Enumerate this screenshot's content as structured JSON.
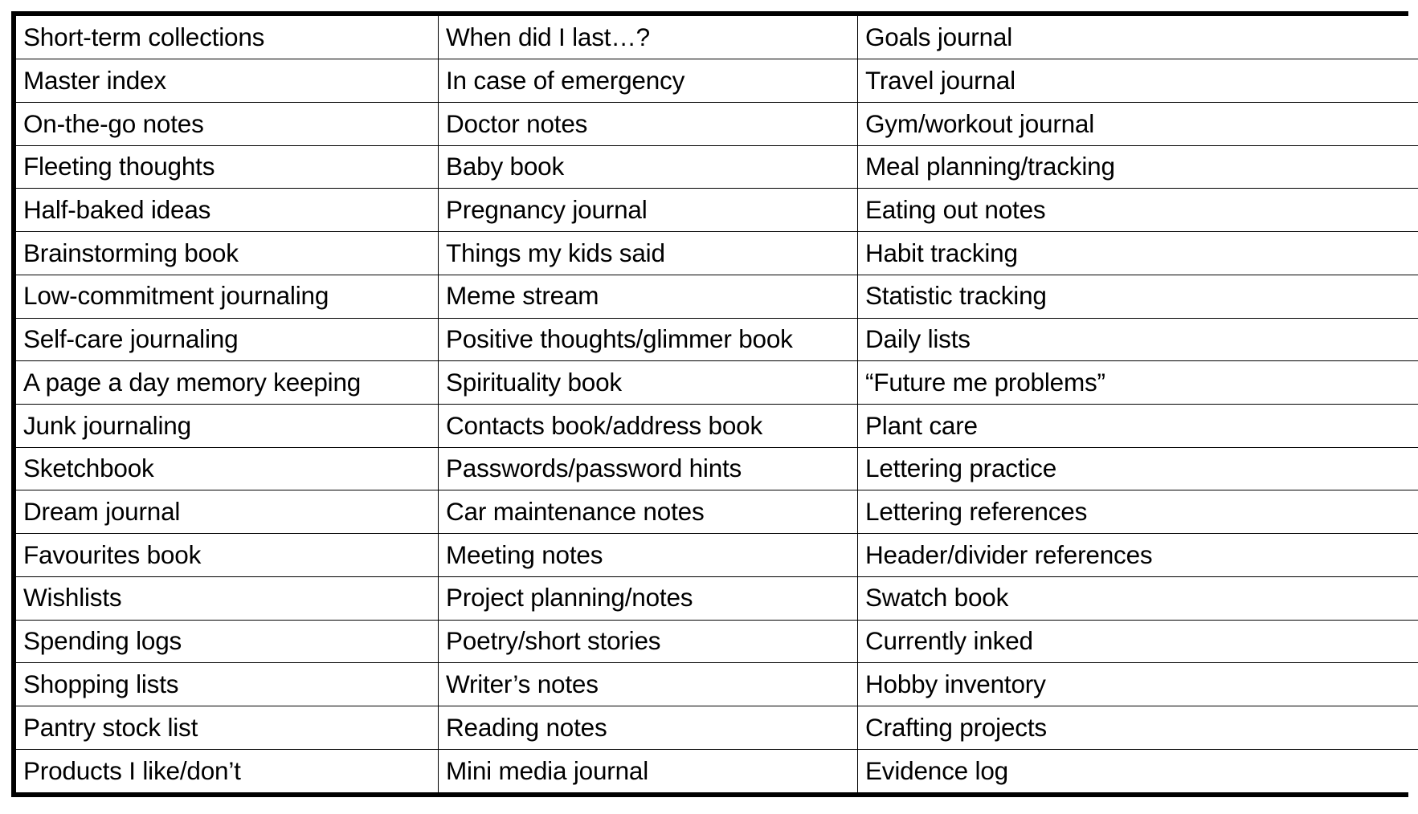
{
  "document": {
    "type": "table",
    "border_color": "#000000",
    "text_color": "#000000",
    "background_color": "#ffffff",
    "column_count": 3,
    "row_count": 20
  },
  "table": {
    "rows": [
      {
        "c1": "Short-term collections",
        "c2": "When did I last…?",
        "c3": "Goals journal"
      },
      {
        "c1": "Master index",
        "c2": "In case of emergency",
        "c3": "Travel journal"
      },
      {
        "c1": "On-the-go notes",
        "c2": "Doctor notes",
        "c3": "Gym/workout journal"
      },
      {
        "c1": "Fleeting thoughts",
        "c2": "Baby book",
        "c3": "Meal planning/tracking"
      },
      {
        "c1": "Half-baked ideas",
        "c2": "Pregnancy journal",
        "c3": "Eating out notes"
      },
      {
        "c1": "Brainstorming book",
        "c2": "Things my kids said",
        "c3": "Habit tracking"
      },
      {
        "c1": "Low-commitment journaling",
        "c2": "Meme stream",
        "c3": "Statistic tracking"
      },
      {
        "c1": "Self-care journaling",
        "c2": "Positive thoughts/glimmer book",
        "c3": "Daily lists"
      },
      {
        "c1": "A page a day memory keeping",
        "c2": "Spirituality book",
        "c3": "“Future me problems”"
      },
      {
        "c1": "Junk journaling",
        "c2": "Contacts book/address book",
        "c3": "Plant care"
      },
      {
        "c1": "Sketchbook",
        "c2": "Passwords/password hints",
        "c3": "Lettering practice"
      },
      {
        "c1": "Dream journal",
        "c2": "Car maintenance notes",
        "c3": "Lettering references"
      },
      {
        "c1": "Favourites book",
        "c2": "Meeting notes",
        "c3": "Header/divider references"
      },
      {
        "c1": "Wishlists",
        "c2": "Project planning/notes",
        "c3": "Swatch book"
      },
      {
        "c1": "Spending logs",
        "c2": "Poetry/short stories",
        "c3": "Currently inked"
      },
      {
        "c1": "Shopping lists",
        "c2": "Writer’s notes",
        "c3": "Hobby inventory"
      },
      {
        "c1": "Pantry stock list",
        "c2": "Reading notes",
        "c3": "Crafting projects"
      },
      {
        "c1": "Products I like/don’t",
        "c2": "Mini media journal",
        "c3": "Evidence log"
      }
    ]
  }
}
